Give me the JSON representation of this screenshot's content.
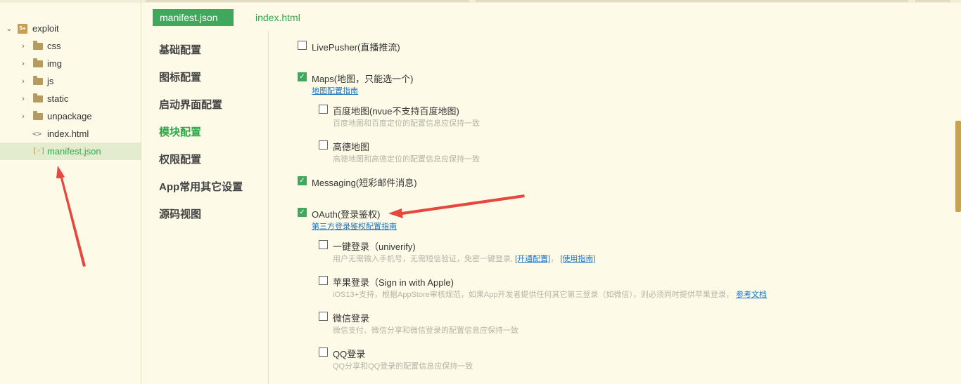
{
  "tree": {
    "project": "exploit",
    "project_icon_text": "5+",
    "items": [
      {
        "label": "css",
        "type": "folder"
      },
      {
        "label": "img",
        "type": "folder"
      },
      {
        "label": "js",
        "type": "folder"
      },
      {
        "label": "static",
        "type": "folder"
      },
      {
        "label": "unpackage",
        "type": "folder"
      },
      {
        "label": "index.html",
        "type": "file"
      },
      {
        "label": "manifest.json",
        "type": "file"
      }
    ]
  },
  "tabs": [
    {
      "label": "manifest.json"
    },
    {
      "label": "index.html"
    }
  ],
  "nav": [
    {
      "label": "基础配置"
    },
    {
      "label": "图标配置"
    },
    {
      "label": "启动界面配置"
    },
    {
      "label": "模块配置"
    },
    {
      "label": "权限配置"
    },
    {
      "label": "App常用其它设置"
    },
    {
      "label": "源码视图"
    }
  ],
  "modules": {
    "livepusher": {
      "label": "LivePusher(直播推流)",
      "checked": false
    },
    "maps": {
      "label": "Maps(地图，只能选一个)",
      "checked": true,
      "link": "地图配置指南"
    },
    "baidu": {
      "label": "百度地图(nvue不支持百度地图)",
      "checked": false,
      "desc": "百度地图和百度定位的配置信息应保持一致"
    },
    "gaode": {
      "label": "高德地图",
      "checked": false,
      "desc": "高德地图和高德定位的配置信息应保持一致"
    },
    "messaging": {
      "label": "Messaging(短彩邮件消息)",
      "checked": true
    },
    "oauth": {
      "label": "OAuth(登录鉴权)",
      "checked": true,
      "link": "第三方登录鉴权配置指南"
    },
    "univerify": {
      "label": "一键登录（univerify)",
      "checked": false,
      "desc": "用户无需输入手机号，无需短信验证，免密一键登录,",
      "link1": "[开通配置]",
      "sep": "，",
      "link2": "[使用指南]"
    },
    "apple": {
      "label": "苹果登录（Sign in with Apple)",
      "checked": false,
      "desc": "iOS13+支持，根据AppStore审核规范，如果App开发者提供任何其它第三登录（如微信），则必须同时提供苹果登录，",
      "link": "参考文档"
    },
    "weixin": {
      "label": "微信登录",
      "checked": false,
      "desc": "微信支付、微信分享和微信登录的配置信息应保持一致"
    },
    "qq": {
      "label": "QQ登录",
      "checked": false,
      "desc": "QQ分享和QQ登录的配置信息应保持一致"
    }
  },
  "colors": {
    "background": "#fdfbe8",
    "accent": "#3fa85c",
    "link": "#1a73c4",
    "arrow": "#e8473e"
  }
}
